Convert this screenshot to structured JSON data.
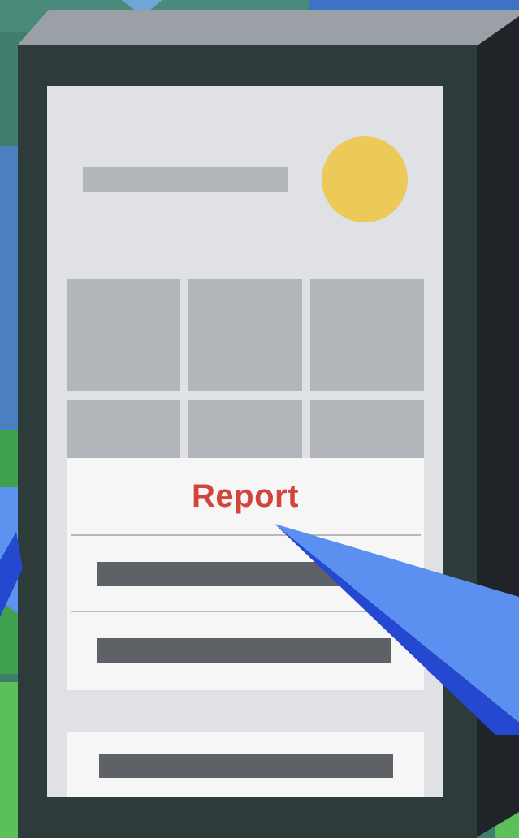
{
  "menu": {
    "report_label": "Report"
  },
  "colors": {
    "accent_red": "#d3453c",
    "avatar_yellow": "#ecc959",
    "pointer_blue": "#5b8ff0",
    "pointer_dark_blue": "#2548d0",
    "device_body": "#2e3d3d",
    "screen_bg": "#dfe1e4"
  },
  "icons": {
    "avatar": "avatar-circle",
    "pointer": "pointer-cone"
  }
}
